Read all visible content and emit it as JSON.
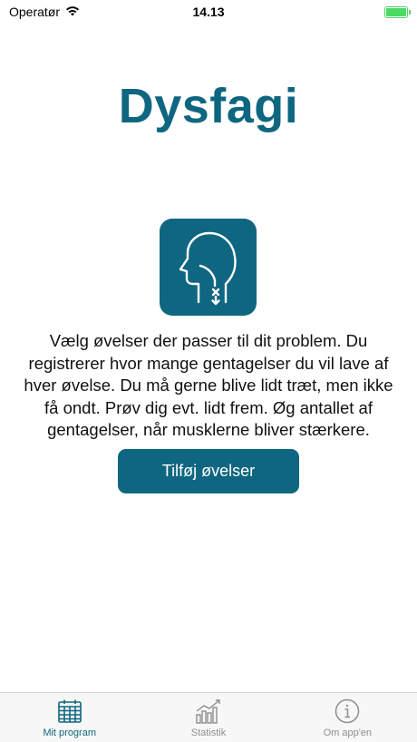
{
  "status_bar": {
    "carrier": "Operatør",
    "time": "14.13",
    "icons": [
      "wifi-icon",
      "battery-icon"
    ]
  },
  "title": "Dysfagi",
  "hero_icon": "head-swallow-icon",
  "instructions": "Vælg øvelser der passer til dit problem. Du registrerer hvor mange gentagelser du vil lave af hver øvelse. Du må gerne blive lidt træt, men ikke få ondt. Prøv dig evt. lidt frem. Øg antallet af gentagelser, når musklerne bliver stærkere.",
  "primary_button": "Tilføj øvelser",
  "tabs": [
    {
      "label": "Mit program",
      "icon": "calendar-icon",
      "active": true
    },
    {
      "label": "Statistik",
      "icon": "bar-chart-icon",
      "active": false
    },
    {
      "label": "Om app'en",
      "icon": "info-icon",
      "active": false
    }
  ],
  "colors": {
    "accent": "#0f6680",
    "inactive": "#8e8e8e",
    "battery": "#4cd964"
  }
}
